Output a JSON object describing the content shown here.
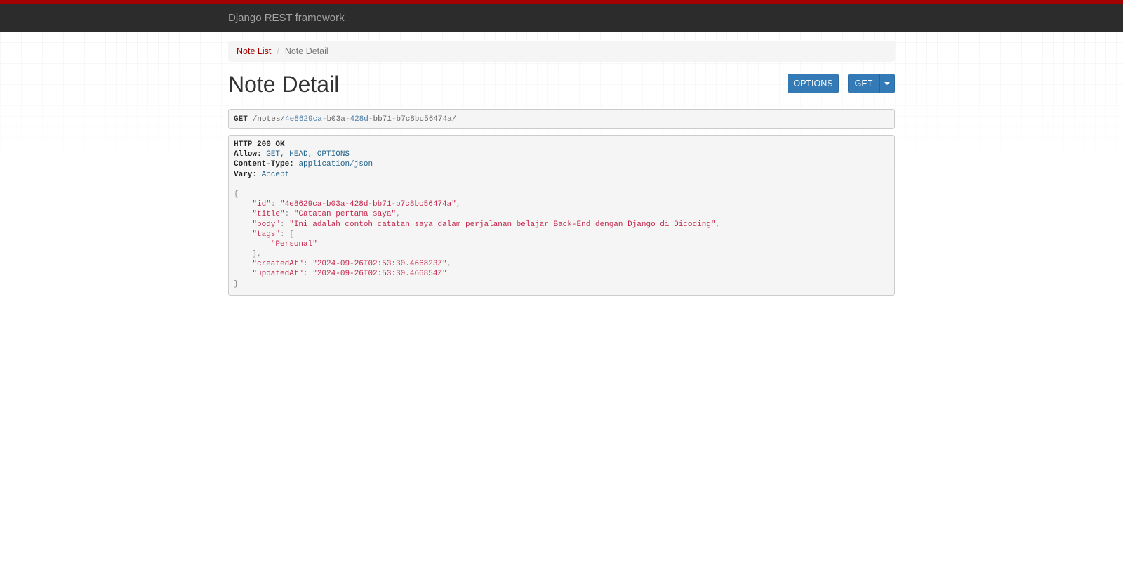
{
  "navbar": {
    "brand": "Django REST framework",
    "accent_color": "#a30000",
    "bg_color": "#2c2c2c"
  },
  "breadcrumb": {
    "items": [
      {
        "label": "Note List",
        "link": true
      },
      {
        "label": "Note Detail",
        "link": false
      }
    ],
    "separator": "/"
  },
  "page": {
    "title": "Note Detail"
  },
  "buttons": {
    "options_label": "OPTIONS",
    "get_label": "GET",
    "get_dropdown_icon": "caret-down-icon",
    "button_color": "#337ab7"
  },
  "request": {
    "method": "GET",
    "path_prefix": "/notes/",
    "path_parts": [
      "4e8629ca",
      "-",
      "b03a",
      "-",
      "428d",
      "-",
      "bb71",
      "-",
      "b7c8bc56474a"
    ],
    "path_suffix": "/"
  },
  "response": {
    "status_line": "HTTP 200 OK",
    "headers": [
      {
        "key": "Allow:",
        "value": "GET, HEAD, OPTIONS"
      },
      {
        "key": "Content-Type:",
        "value": "application/json"
      },
      {
        "key": "Vary:",
        "value": "Accept"
      }
    ],
    "body": {
      "open": "{",
      "close": "}",
      "id_key": "\"id\"",
      "id_value": "\"4e8629ca-b03a-428d-bb71-b7c8bc56474a\"",
      "title_key": "\"title\"",
      "title_value": "\"Catatan pertama saya\"",
      "body_key": "\"body\"",
      "body_value": "\"Ini adalah contoh catatan saya dalam perjalanan belajar Back-End dengan Django di Dicoding\"",
      "tags_key": "\"tags\"",
      "tags_open": "[",
      "tags_items": [
        "\"Personal\""
      ],
      "tags_close": "],",
      "createdAt_key": "\"createdAt\"",
      "createdAt_value": "\"2024-09-26T02:53:30.466823Z\"",
      "updatedAt_key": "\"updatedAt\"",
      "updatedAt_value": "\"2024-09-26T02:53:30.466854Z\""
    }
  }
}
